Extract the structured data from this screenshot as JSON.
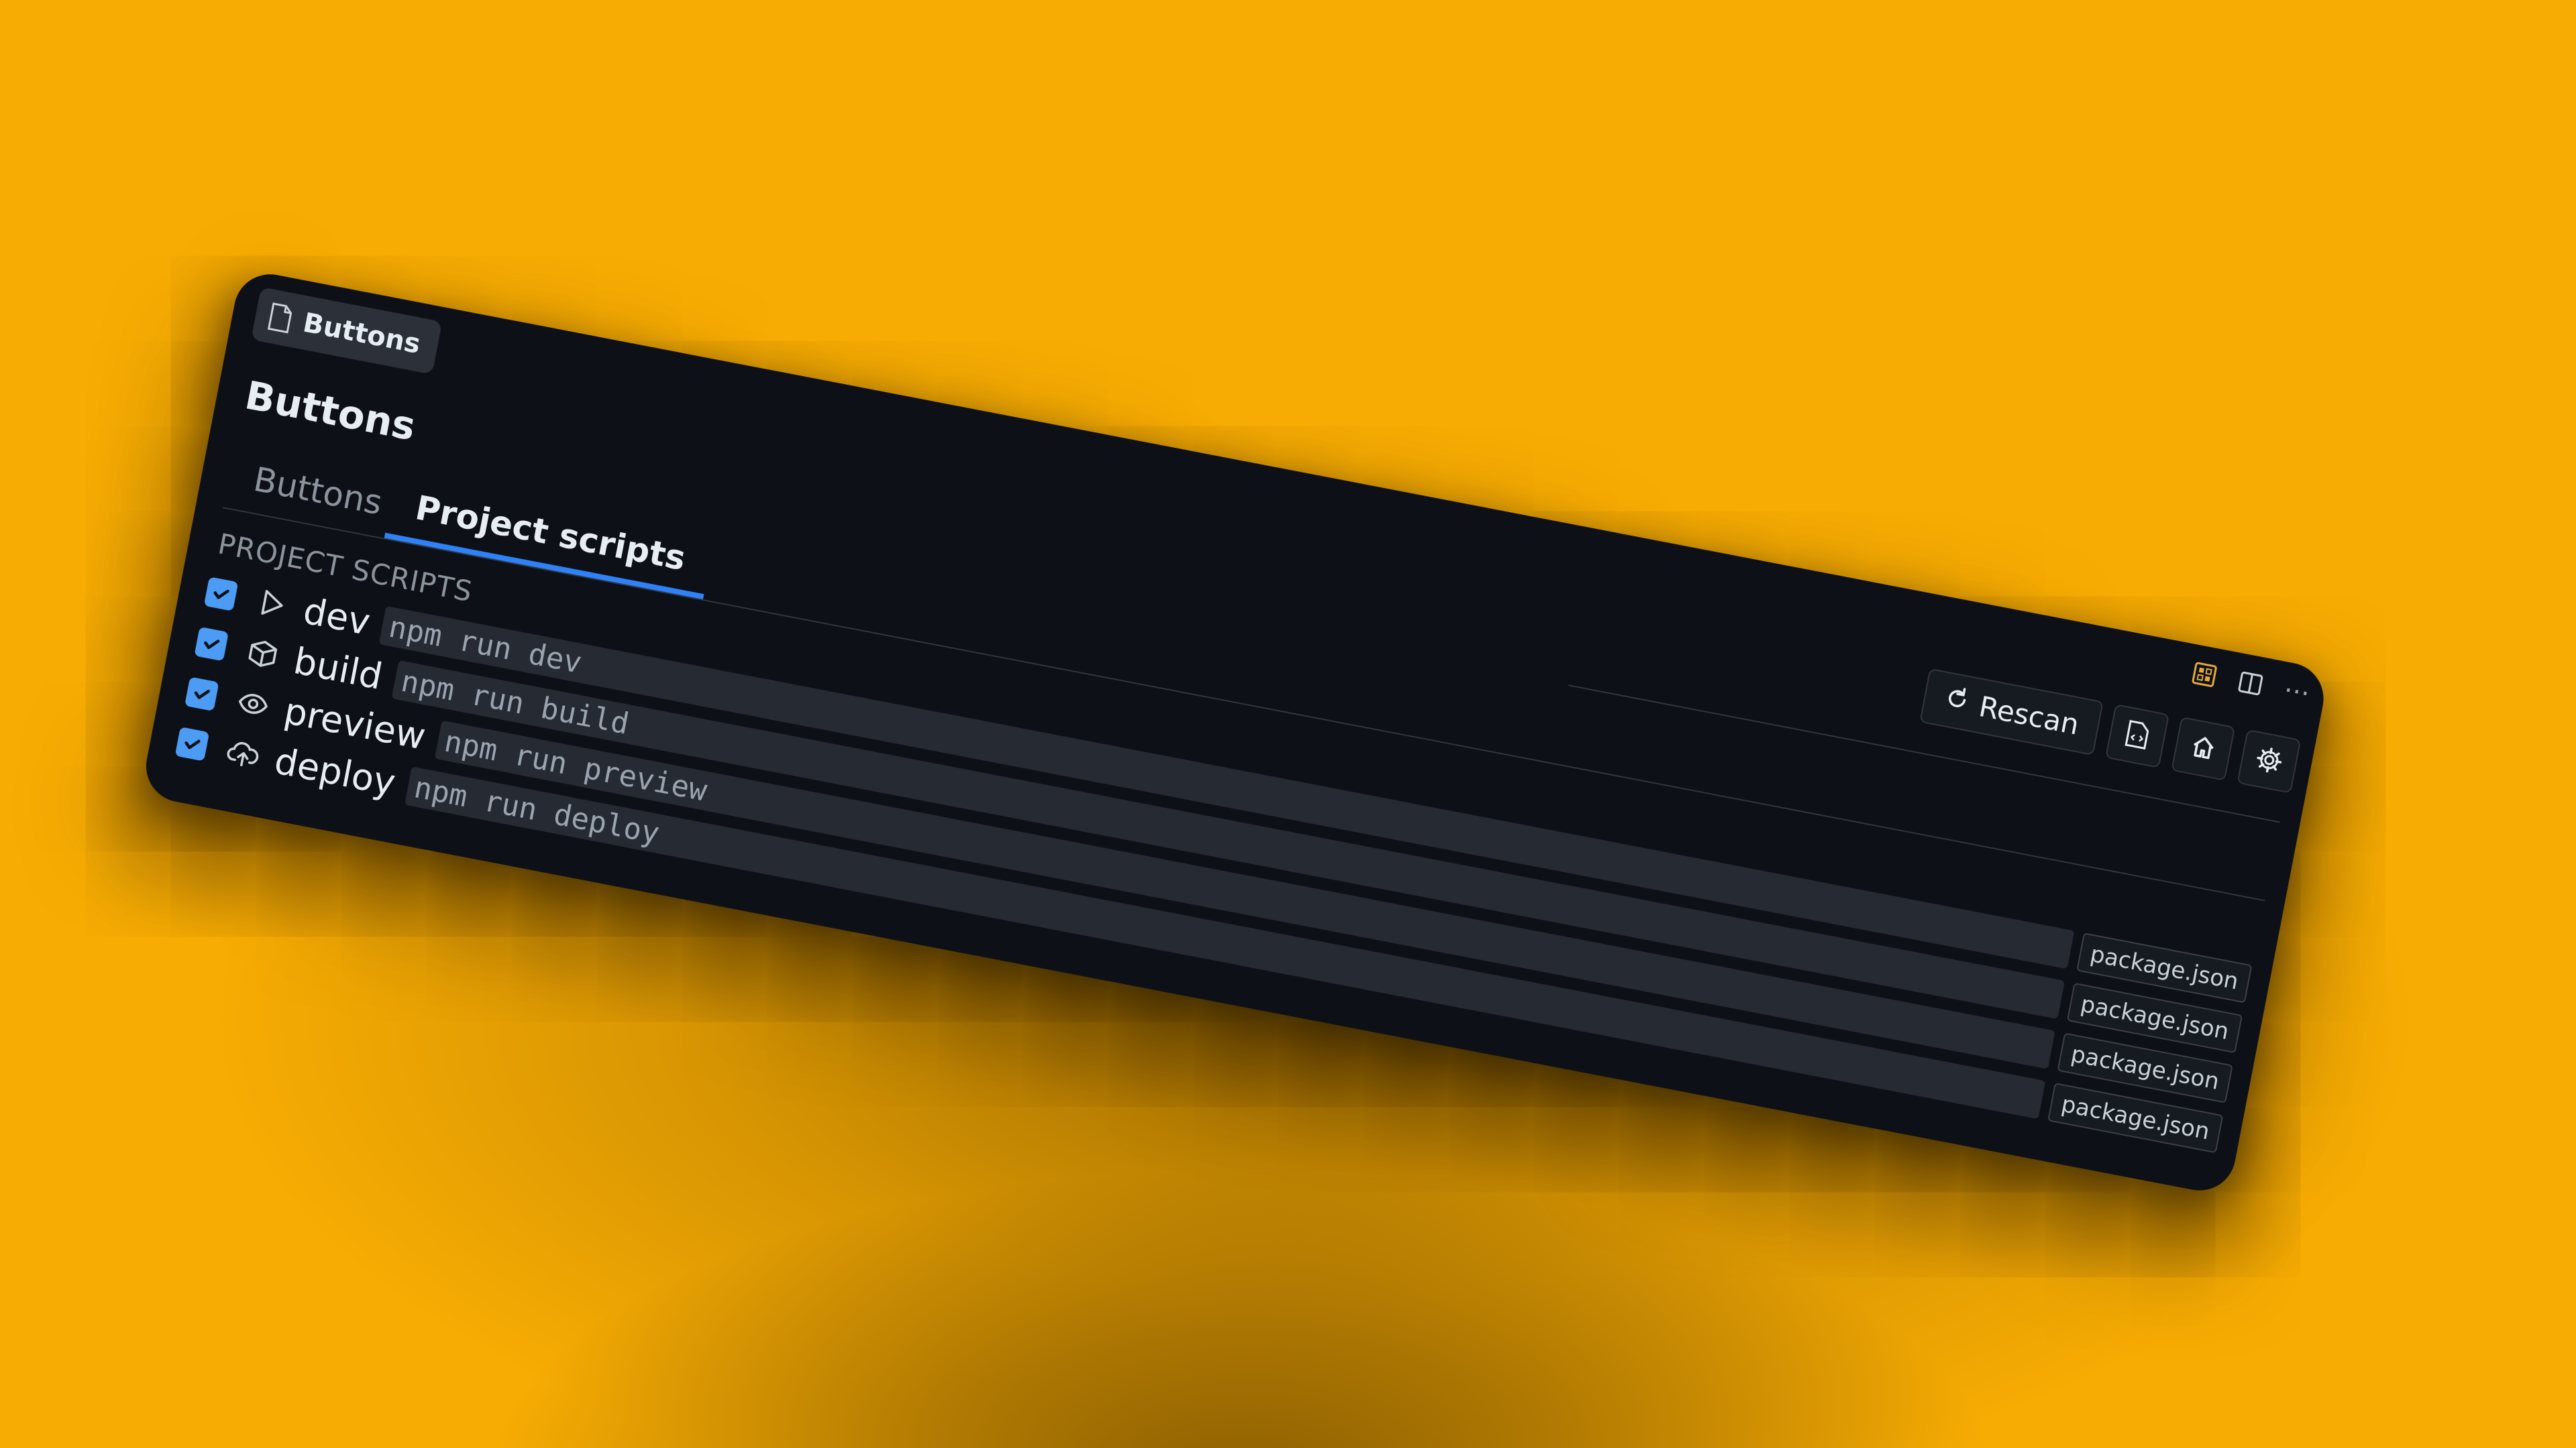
{
  "editor_tab": {
    "label": "Buttons",
    "icon": "file-icon"
  },
  "page_title": "Buttons",
  "tabs": [
    {
      "label": "Buttons",
      "active": false
    },
    {
      "label": "Project scripts",
      "active": true
    }
  ],
  "section_label": "PROJECT SCRIPTS",
  "scripts": [
    {
      "checked": true,
      "icon": "play-icon",
      "name": "dev",
      "command": "npm run dev",
      "source": "package.json"
    },
    {
      "checked": true,
      "icon": "package-icon",
      "name": "build",
      "command": "npm run build",
      "source": "package.json"
    },
    {
      "checked": true,
      "icon": "eye-icon",
      "name": "preview",
      "command": "npm run preview",
      "source": "package.json"
    },
    {
      "checked": true,
      "icon": "cloud-upload-icon",
      "name": "deploy",
      "command": "npm run deploy",
      "source": "package.json"
    }
  ],
  "toolbar": {
    "rescan_label": "Rescan",
    "more_label": "···"
  },
  "colors": {
    "background": "#f7ac03",
    "panel": "#0d1117",
    "accent": "#2f81f7",
    "checkbox": "#4c9cf5",
    "extension_icon": "#e3a93c"
  }
}
